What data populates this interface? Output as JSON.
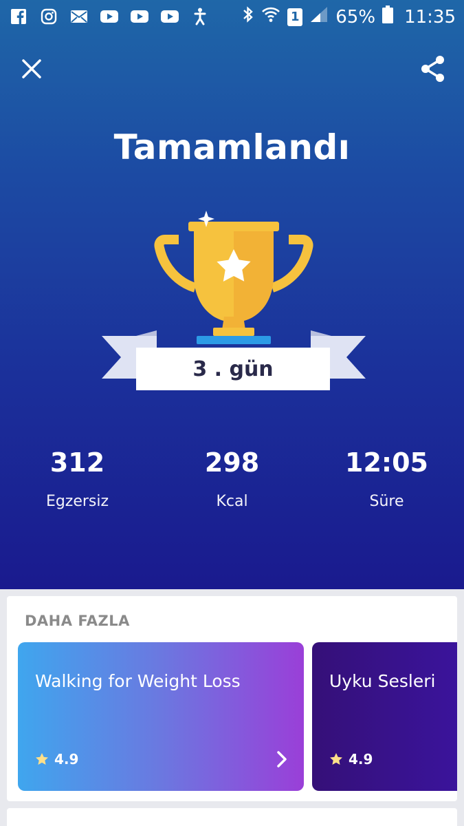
{
  "status_bar": {
    "battery": "65%",
    "time": "11:35",
    "sim": "1",
    "left_icons": [
      "facebook-icon",
      "instagram-icon",
      "mail-icon",
      "youtube-icon",
      "youtube-icon",
      "youtube-icon",
      "accessibility-icon"
    ],
    "right_icons": [
      "bluetooth-icon",
      "wifi-icon",
      "sim-icon",
      "signal-icon",
      "battery-icon"
    ]
  },
  "header": {
    "close_icon": "close-icon",
    "share_icon": "share-icon"
  },
  "title": "Tamamlandı",
  "day_badge": "3 . gün",
  "stats": [
    {
      "value": "312",
      "label": "Egzersiz"
    },
    {
      "value": "298",
      "label": "Kcal"
    },
    {
      "value": "12:05",
      "label": "Süre"
    }
  ],
  "more": {
    "title": "DAHA FAZLA",
    "plans": [
      {
        "title": "Walking for Weight Loss",
        "rating": "4.9"
      },
      {
        "title": "Uyku Sesleri",
        "rating": "4.9"
      }
    ]
  },
  "colors": {
    "hero_top": "#1f67a8",
    "hero_bottom": "#1a1a8e",
    "trophy_gold": "#f6c23e",
    "ribbon": "#dfe3f3"
  }
}
